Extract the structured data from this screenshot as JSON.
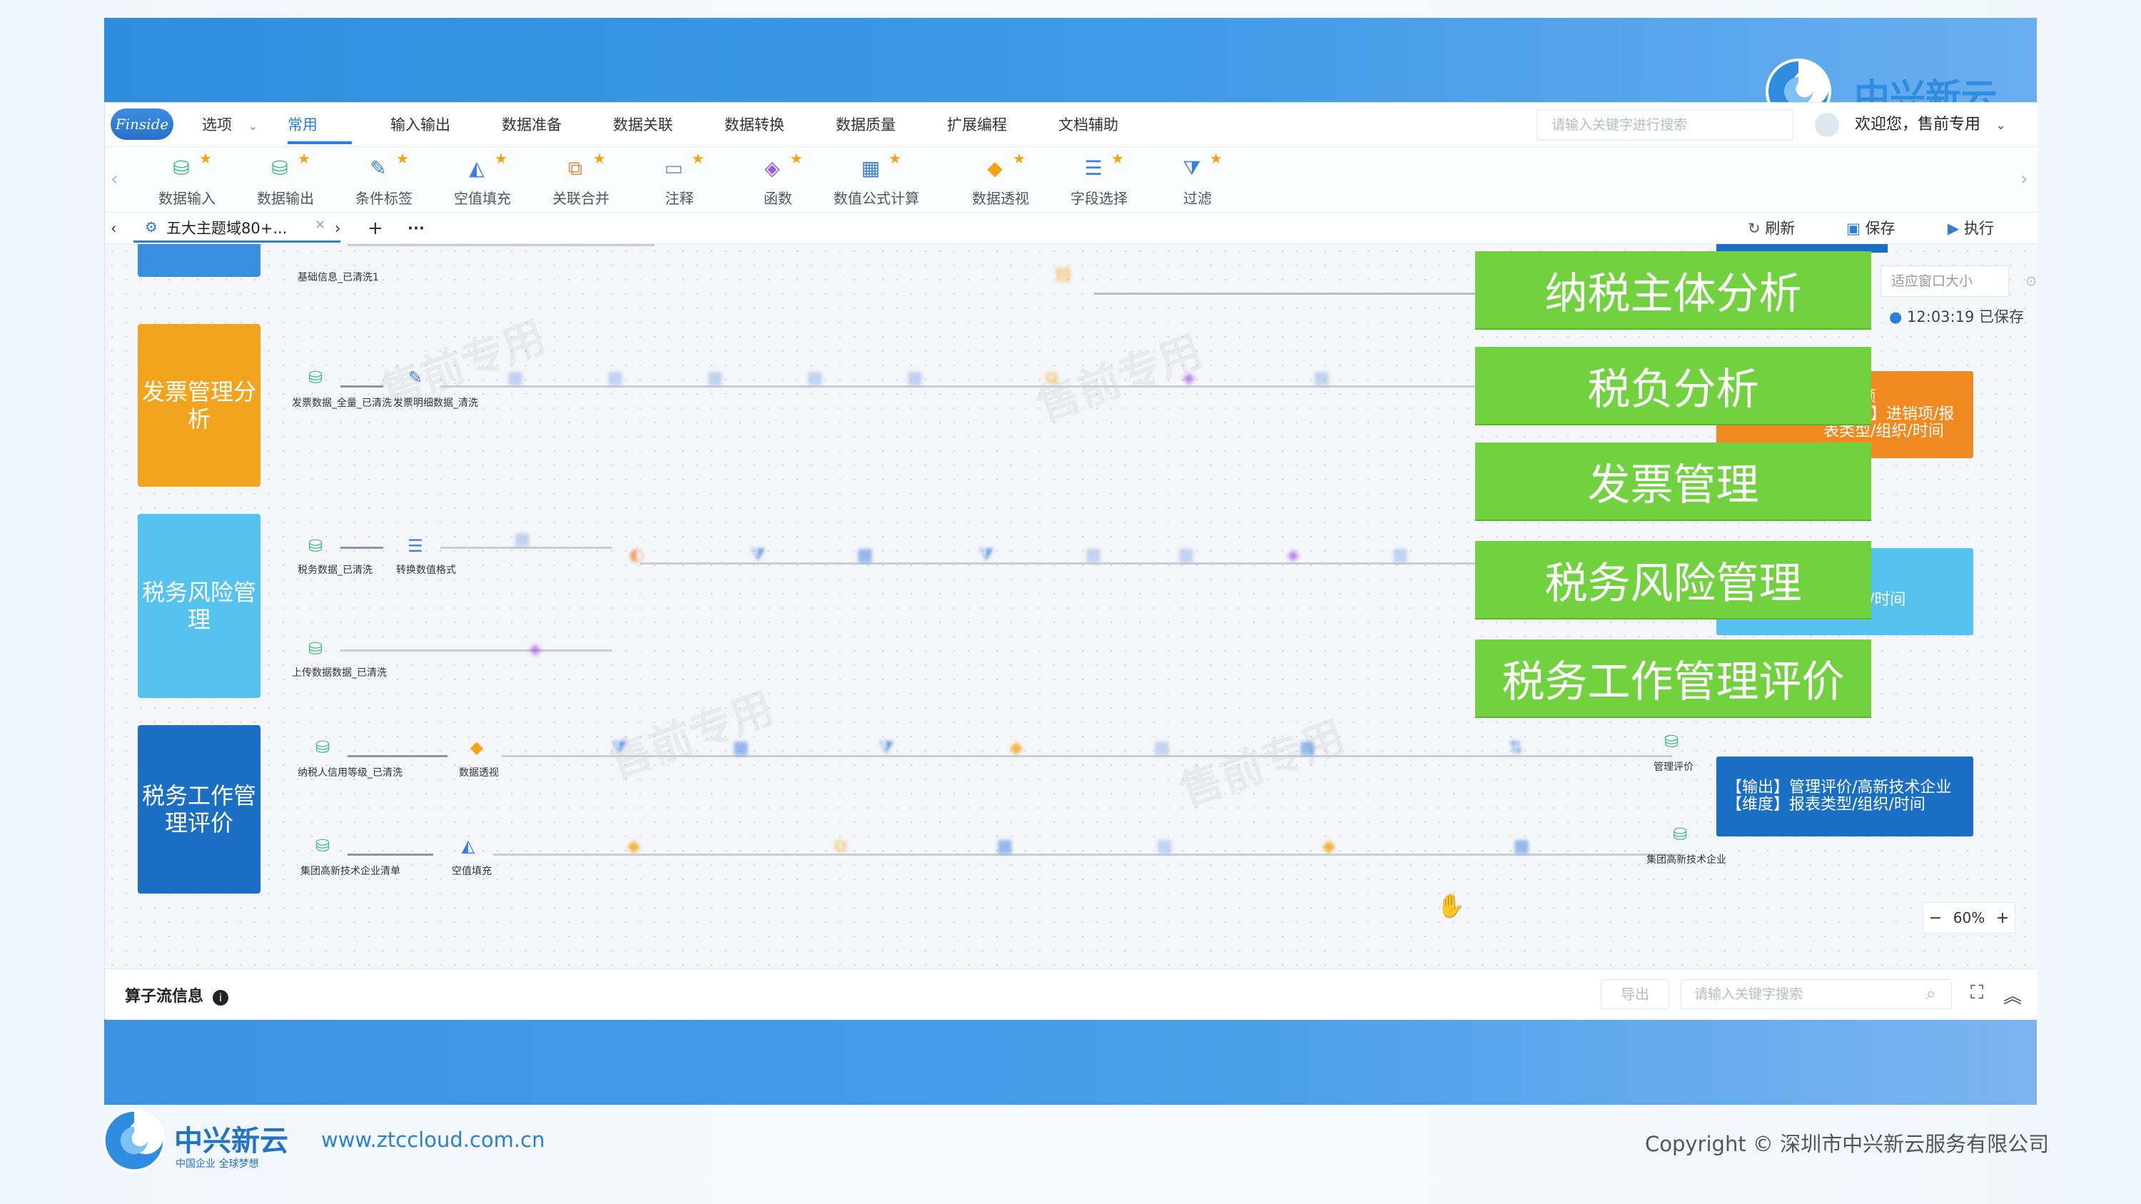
{
  "brand": {
    "name": "中兴新云",
    "slogan": "中国企业 全球梦想",
    "app_logo": "Finside"
  },
  "menubar": {
    "options_label": "选项",
    "menus": [
      "常用",
      "输入输出",
      "数据准备",
      "数据关联",
      "数据转换",
      "数据质量",
      "扩展编程",
      "文档辅助"
    ],
    "active_menu": "常用",
    "search_placeholder": "请输入关键字进行搜索",
    "welcome": "欢迎您，售前专用"
  },
  "toolbar": {
    "tools": [
      {
        "label": "数据输入",
        "icon": "database-add-icon",
        "color": "#3bbf7a"
      },
      {
        "label": "数据输出",
        "icon": "database-export-icon",
        "color": "#3bbf7a"
      },
      {
        "label": "条件标签",
        "icon": "tag-edit-icon",
        "color": "#3d7fe0"
      },
      {
        "label": "空值填充",
        "icon": "paint-bucket-icon",
        "color": "#3d7fe0"
      },
      {
        "label": "关联合并",
        "icon": "merge-icon",
        "color": "#f08a4b"
      },
      {
        "label": "注释",
        "icon": "comment-icon",
        "color": "#8a94a3"
      },
      {
        "label": "函数",
        "icon": "function-icon",
        "color": "#9a5ae0"
      },
      {
        "label": "数值公式计算",
        "icon": "calculator-icon",
        "color": "#3d7fe0"
      },
      {
        "label": "数据透视",
        "icon": "layers-icon",
        "color": "#f3a312"
      },
      {
        "label": "字段选择",
        "icon": "field-select-icon",
        "color": "#3d7fe0"
      },
      {
        "label": "过滤",
        "icon": "filter-icon",
        "color": "#3d7fe0"
      }
    ]
  },
  "tabbar": {
    "active_tab": "五大主题域80+...",
    "actions": {
      "refresh": "刷新",
      "save": "保存",
      "run": "执行"
    }
  },
  "canvas": {
    "fit_window": "适应窗口大小",
    "saved_status": "12:03:19 已保存",
    "zoom": "60%",
    "categories": [
      {
        "label": "发票管理分析",
        "color": "#f3a41e"
      },
      {
        "label": "税务风险管理",
        "color": "#56c3ef"
      },
      {
        "label": "税务工作管理评价",
        "color": "#1a6fc4"
      }
    ],
    "themes": [
      "纳税主体分析",
      "税负分析",
      "发票管理",
      "税务风险管理",
      "税务工作管理评价"
    ],
    "node_labels": {
      "r0_a": "基础信息_已清洗1",
      "r1_a": "发票数据_全量_已清洗",
      "r1_b": "发票明细数据_清洗",
      "r2_a": "税务数据_已清洗",
      "r2_b": "转换数值格式",
      "r2_c": "上传数据数据_已清洗",
      "r3_a": "纳税人信用等级_已清洗",
      "r3_b": "数据透视",
      "r3_c": "管理评价",
      "r4_a": "集团高新技术企业清单",
      "r4_b": "空值填充",
      "r4_c": "集团高新技术企业"
    },
    "output_boxes": {
      "tax_burden": "额/税额\n【维度】进销项/报表类型/组织/时间",
      "risk": "风险\n组织/时间",
      "evaluation": "【输出】管理评价/高新技术企业\n【维度】报表类型/组织/时间"
    }
  },
  "bottom_panel": {
    "title": "算子流信息",
    "export": "导出",
    "search_placeholder": "请输入关键字搜索"
  },
  "footer": {
    "url": "www.ztccloud.com.cn",
    "copyright": "Copyright © 深圳市中兴新云服务有限公司"
  },
  "watermark_text": "售前专用"
}
